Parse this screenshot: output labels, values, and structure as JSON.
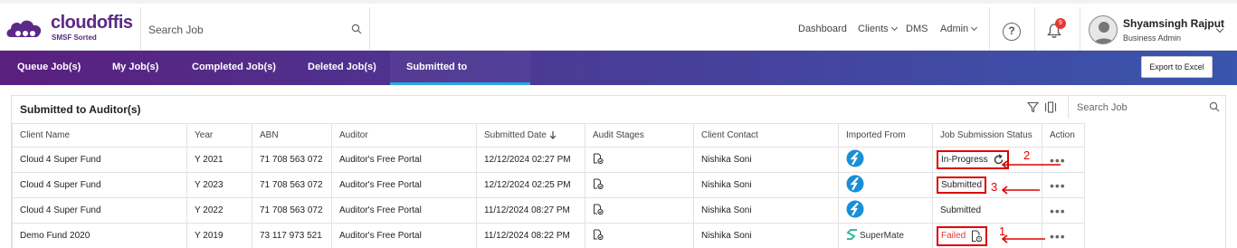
{
  "header": {
    "brand": "cloudoffis",
    "tagline": "SMSF Sorted",
    "search_placeholder": "Search Job",
    "nav": [
      {
        "label": "Dashboard",
        "has_dropdown": false
      },
      {
        "label": "Clients",
        "has_dropdown": true
      },
      {
        "label": "DMS",
        "has_dropdown": false
      },
      {
        "label": "Admin",
        "has_dropdown": true
      }
    ],
    "help_label": "?",
    "notification_count": "9",
    "user_name": "Shyamsingh Rajput",
    "user_role": "Business Admin"
  },
  "tabs": [
    {
      "label": "Queue Job(s)",
      "active": false
    },
    {
      "label": "My Job(s)",
      "active": false
    },
    {
      "label": "Completed Job(s)",
      "active": false
    },
    {
      "label": "Deleted Job(s)",
      "active": false
    },
    {
      "label": "Submitted to Auditor(s)",
      "active": true
    }
  ],
  "export_label": "Export to Excel",
  "panel": {
    "title": "Submitted to Auditor(s)",
    "search_placeholder": "Search Job"
  },
  "table": {
    "columns": [
      "Client Name",
      "Year",
      "ABN",
      "Auditor",
      "Submitted Date",
      "Audit Stages",
      "Client Contact",
      "Imported From",
      "Job Submission Status",
      "Action"
    ],
    "sorted_column": "Submitted Date",
    "sort_direction": "descending",
    "rows": [
      {
        "client": "Cloud 4 Super Fund",
        "year": "Y 2021",
        "abn": "71 708 563 072",
        "auditor": "Auditor's Free Portal",
        "date": "12/12/2024 02:27 PM",
        "contact": "Nishika Soni",
        "imported_from": "class-logo",
        "imported_text": "",
        "status": "In-Progress",
        "status_icon": "refresh-icon",
        "action": "•••"
      },
      {
        "client": "Cloud 4 Super Fund",
        "year": "Y 2023",
        "abn": "71 708 563 072",
        "auditor": "Auditor's Free Portal",
        "date": "12/12/2024 02:25 PM",
        "contact": "Nishika Soni",
        "imported_from": "class-logo",
        "imported_text": "",
        "status": "Submitted",
        "status_icon": "",
        "action": "•••"
      },
      {
        "client": "Cloud 4 Super Fund",
        "year": "Y 2022",
        "abn": "71 708 563 072",
        "auditor": "Auditor's Free Portal",
        "date": "11/12/2024 08:27 PM",
        "contact": "Nishika Soni",
        "imported_from": "class-logo",
        "imported_text": "",
        "status": "Submitted",
        "status_icon": "",
        "action": "•••"
      },
      {
        "client": "Demo Fund 2020",
        "year": "Y 2019",
        "abn": "73 117 973 521",
        "auditor": "Auditor's Free Portal",
        "date": "11/12/2024 08:22 PM",
        "contact": "Nishika Soni",
        "imported_from": "supermate-logo",
        "imported_text": "SuperMate",
        "status": "Failed",
        "status_icon": "document-error-icon",
        "action": "•••"
      }
    ]
  },
  "annotations": [
    "2",
    "3",
    "1"
  ],
  "colors": {
    "brand_purple": "#5b2a86",
    "tab_gradient_start": "#5a1f7f",
    "tab_gradient_end": "#3a55ad",
    "active_tab_underline": "#29a8e0",
    "failed_red": "#e53935",
    "annotation_red": "#dd0000",
    "class_logo_blue": "#1a8fd6",
    "supermate_green": "#3bb89b"
  }
}
